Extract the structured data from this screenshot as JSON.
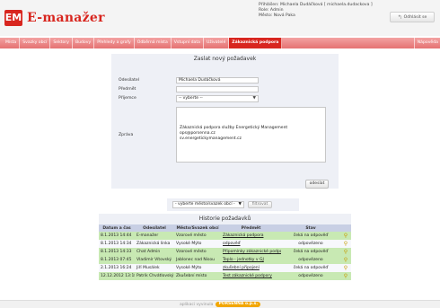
{
  "app": {
    "logo_badge": "EM",
    "logo_text": "E-manažer"
  },
  "user": {
    "logged_in_line": "Přihlášen: Michaela Dudáčková [ michaela.dudackova ]",
    "role_line": "Role: Admin",
    "city_line": "Město: Nová Paka",
    "logout_label": "Odhlásit se",
    "logout_icon": "logout-arrow-icon"
  },
  "nav": {
    "items": [
      {
        "label": "Místa",
        "active": false
      },
      {
        "label": "Svazky obcí",
        "active": false
      },
      {
        "label": "Sektory",
        "active": false
      },
      {
        "label": "Budovy",
        "active": false
      },
      {
        "label": "Přehledy a grafy",
        "active": false
      },
      {
        "label": "Odběrná místa",
        "active": false
      },
      {
        "label": "Vstupní data",
        "active": false
      },
      {
        "label": "Uživatelé",
        "active": false
      },
      {
        "label": "Zákaznická podpora",
        "active": true
      }
    ],
    "help_label": "Nápověda"
  },
  "form": {
    "title": "Zaslat nový požadavek",
    "sender_label": "Odesílatel",
    "sender_value": "Michaela Dudáčková",
    "subject_label": "Předmět",
    "subject_value": "",
    "recipient_label": "Příjemce",
    "recipient_value": "-- vyberte --",
    "message_label": "Zpráva",
    "message_lines": [
      "Zákaznická podpora služby Energetický Management",
      "ops@porsenna.cz",
      "sv.energetickymanagement.cz"
    ],
    "send_label": "odeslat"
  },
  "filter": {
    "select_value": "- vyberte město/svazek obcí -",
    "button_label": "filtrovat"
  },
  "history": {
    "title": "Historie požadavků",
    "columns": [
      "Datum a čas",
      "Odesílatel",
      "Město/Svazek obcí",
      "Předmět",
      "Stav",
      ""
    ],
    "rows": [
      {
        "date": "8.1.2013 14:44",
        "sender": "E-manažer",
        "city": "Vzorové město",
        "subject": "Zákaznická podpora",
        "status": "čeká na odpověď",
        "color": "green"
      },
      {
        "date": "8.1.2013 14:34",
        "sender": "Zákaznická linka",
        "city": "Vysoké Mýto",
        "subject": "odpověď",
        "status": "odpovězeno",
        "color": "white"
      },
      {
        "date": "8.1.2013 14:33",
        "sender": "Chat Admin",
        "city": "Vzorové město",
        "subject": "Připomínky zákaznické podpory",
        "status": "čeká na odpověď",
        "color": "green"
      },
      {
        "date": "8.1.2013 07:45",
        "sender": "Vladimír Vítovský",
        "city": "Jablonec nad Nisou",
        "subject": "Teplo - jednotky v GJ",
        "status": "odpovězeno",
        "color": "green"
      },
      {
        "date": "2.1.2013 16:24",
        "sender": "Jiří Musálek",
        "city": "Vysoké Mýto",
        "subject": "zkušební připojení",
        "status": "čeká na odpověď",
        "color": "white"
      },
      {
        "date": "12.12.2012 13:18",
        "sender": "Patrik Chvátlovský",
        "city": "Zkušební místo",
        "subject": "Test zákaznické podpory",
        "status": "odpovězeno",
        "color": "green"
      }
    ]
  },
  "footer": {
    "text": "aplikaci vyvinula",
    "brand": "PORSENNA o.p.s."
  },
  "colors": {
    "brand_red": "#d8261f",
    "nav_pink": "#e57272",
    "row_green": "#c8e9b3",
    "header_blue": "#c8cfe4"
  }
}
